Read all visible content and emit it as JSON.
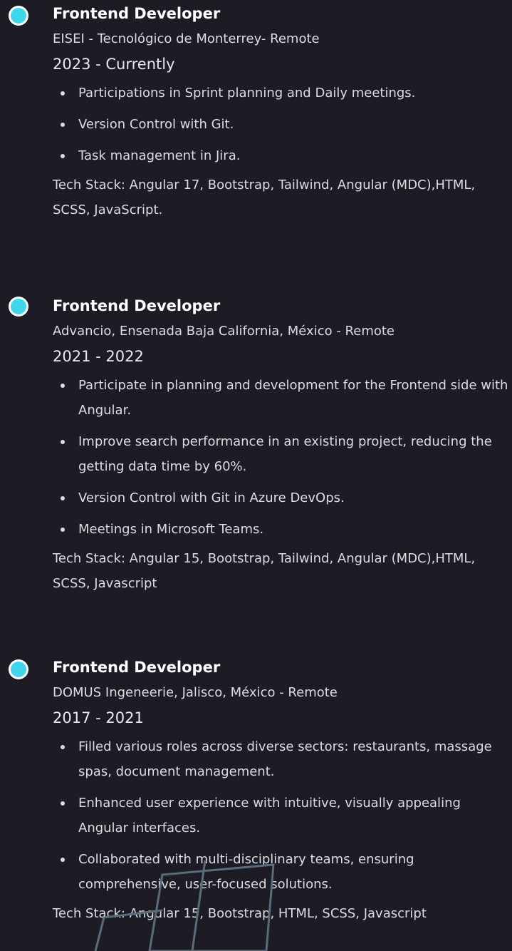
{
  "experience": [
    {
      "title": "Frontend Developer",
      "company": "EISEI - Tecnológico de Monterrey- Remote",
      "dates": "2023 - Currently",
      "bullets": [
        "Participations in Sprint planning and Daily meetings.",
        "Version Control with Git.",
        "Task management in Jira."
      ],
      "stack": "Tech Stack: Angular 17, Bootstrap, Tailwind, Angular (MDC),HTML, SCSS, JavaScript."
    },
    {
      "title": "Frontend Developer",
      "company": "Advancio, Ensenada Baja California, México - Remote",
      "dates": "2021 - 2022",
      "bullets": [
        "Participate in planning and development for the Frontend side with Angular.",
        "Improve search performance in an existing project, reducing the getting data time by 60%.",
        "Version Control with Git in Azure DevOps.",
        "Meetings in Microsoft Teams."
      ],
      "stack": "Tech Stack: Angular 15, Bootstrap, Tailwind, Angular (MDC),HTML, SCSS, Javascript"
    },
    {
      "title": "Frontend Developer",
      "company": "DOMUS Ingeneerie, Jalisco, México - Remote",
      "dates": "2017 - 2021",
      "bullets": [
        "Filled various roles across diverse sectors: restaurants, massage spas, document management.",
        "Enhanced user experience with intuitive, visually appealing Angular interfaces.",
        "Collaborated with multi-disciplinary teams, ensuring comprehensive, user-focused solutions."
      ],
      "stack": "Tech Stack: Angular 15, Bootstrap, HTML, SCSS, Javascript"
    }
  ],
  "colors": {
    "background": "#1d1c25",
    "accent_dot": "#3fd6ea",
    "decor_line": "#5a6c7c"
  }
}
